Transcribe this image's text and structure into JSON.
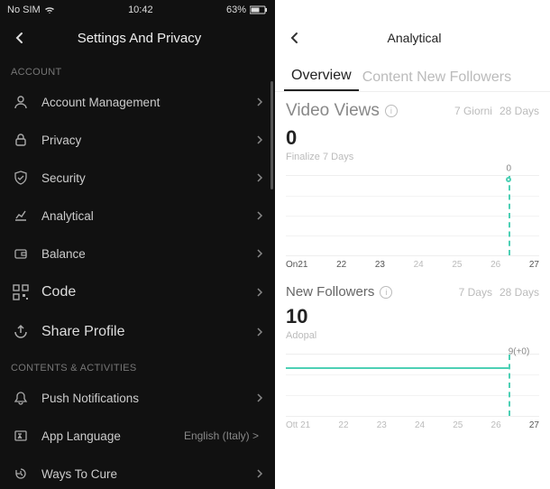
{
  "status": {
    "carrier": "No SIM",
    "time": "10:42",
    "battery": "63%"
  },
  "left": {
    "title": "Settings And Privacy",
    "sections": {
      "account": {
        "header": "ACCOUNT",
        "items": [
          {
            "label": "Account Management"
          },
          {
            "label": "Privacy"
          },
          {
            "label": "Security"
          },
          {
            "label": "Analytical"
          },
          {
            "label": "Balance"
          },
          {
            "label": "Code"
          },
          {
            "label": "Share Profile"
          }
        ]
      },
      "contents": {
        "header": "CONTENTS & ACTIVITIES",
        "items": [
          {
            "label": "Push Notifications"
          },
          {
            "label": "App Language",
            "sub": "English (Italy) >"
          },
          {
            "label": "Ways To Cure"
          }
        ]
      }
    }
  },
  "right": {
    "title": "Analytical",
    "tabs": {
      "active": "Overview",
      "rest": "Content New Followers"
    },
    "video_views": {
      "title": "Video Views",
      "ranges": {
        "r1": "7 Giorni",
        "r2": "28 Days"
      },
      "value": "0",
      "subtitle": "Finalize 7 Days",
      "point_label": "0"
    },
    "new_followers": {
      "title": "New Followers",
      "ranges": {
        "r1": "7 Days",
        "r2": "28 Days"
      },
      "value": "10",
      "subtitle": "Adopal",
      "point_label": "9(+0)"
    }
  },
  "chart_data": [
    {
      "type": "line",
      "title": "Video Views",
      "categories": [
        "On21",
        "22",
        "23",
        "24",
        "25",
        "26",
        "27"
      ],
      "values": [
        null,
        null,
        null,
        null,
        null,
        null,
        0
      ],
      "ylim": [
        0,
        1
      ],
      "selected_index": 6
    },
    {
      "type": "line",
      "title": "New Followers",
      "categories": [
        "Ott 21",
        "22",
        "23",
        "24",
        "25",
        "26",
        "27"
      ],
      "values": [
        9,
        9,
        9,
        9,
        9,
        9,
        9
      ],
      "ylim": [
        0,
        10
      ],
      "selected_index": 6
    }
  ]
}
